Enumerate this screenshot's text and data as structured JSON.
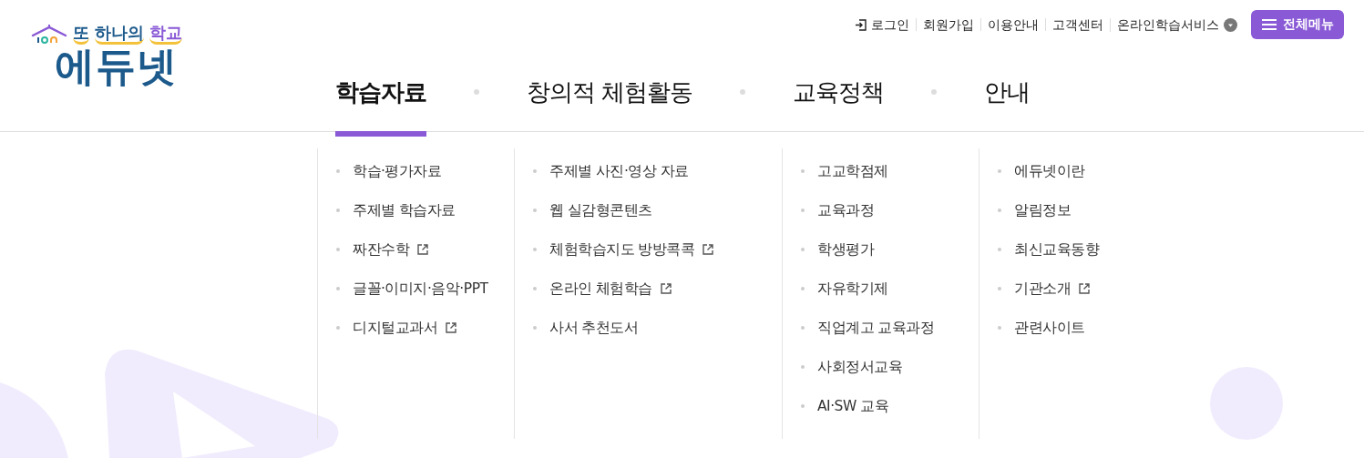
{
  "logo": {
    "tagline_parts": [
      {
        "text": "또",
        "accent": false
      },
      {
        "text": "하나의",
        "accent": false
      },
      {
        "text": "학교",
        "accent": true
      }
    ],
    "name": "에듀넷"
  },
  "utility_links": [
    {
      "label": "로그인",
      "kind": "login"
    },
    {
      "label": "회원가입",
      "kind": "link"
    },
    {
      "label": "이용안내",
      "kind": "link"
    },
    {
      "label": "고객센터",
      "kind": "link"
    },
    {
      "label": "온라인학습서비스",
      "kind": "dropdown"
    }
  ],
  "all_menu_button": "전체메뉴",
  "nav": [
    {
      "label": "학습자료",
      "selected": true
    },
    {
      "label": "창의적 체험활동",
      "selected": false
    },
    {
      "label": "교육정책",
      "selected": false
    },
    {
      "label": "안내",
      "selected": false
    }
  ],
  "submenu_columns": [
    {
      "items": [
        {
          "label": "학습·평가자료",
          "external": false
        },
        {
          "label": "주제별 학습자료",
          "external": false
        },
        {
          "label": "짜잔수학",
          "external": true
        },
        {
          "label": "글꼴·이미지·음악·PPT",
          "external": false
        },
        {
          "label": "디지털교과서",
          "external": true
        }
      ]
    },
    {
      "items": [
        {
          "label": "주제별 사진·영상 자료",
          "external": false
        },
        {
          "label": "웹 실감형콘텐츠",
          "external": false
        },
        {
          "label": "체험학습지도 방방콕콕",
          "external": true
        },
        {
          "label": "온라인 체험학습",
          "external": true
        },
        {
          "label": "사서 추천도서",
          "external": false
        }
      ]
    },
    {
      "items": [
        {
          "label": "고교학점제",
          "external": false
        },
        {
          "label": "교육과정",
          "external": false
        },
        {
          "label": "학생평가",
          "external": false
        },
        {
          "label": "자유학기제",
          "external": false
        },
        {
          "label": "직업계고 교육과정",
          "external": false
        },
        {
          "label": "사회정서교육",
          "external": false
        },
        {
          "label": "AI·SW 교육",
          "external": false
        }
      ]
    },
    {
      "items": [
        {
          "label": "에듀넷이란",
          "external": false
        },
        {
          "label": "알림정보",
          "external": false
        },
        {
          "label": "최신교육동향",
          "external": false
        },
        {
          "label": "기관소개",
          "external": true
        },
        {
          "label": "관련사이트",
          "external": false
        }
      ]
    }
  ]
}
